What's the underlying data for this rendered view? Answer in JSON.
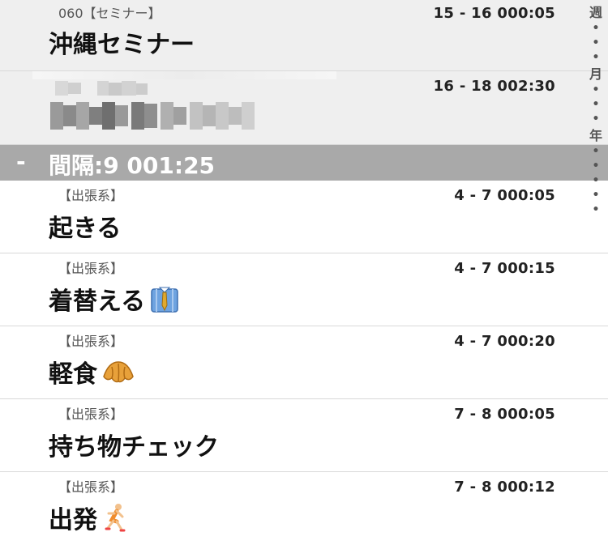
{
  "index_bar": {
    "week": "週",
    "month": "月",
    "year": "年"
  },
  "rows_top": [
    {
      "category": "060【セミナー】",
      "time": "15 - 16 000:05",
      "title": "沖縄セミナー"
    },
    {
      "category": "",
      "time": "16 - 18 002:30",
      "title": ""
    }
  ],
  "separator": {
    "dash": "-",
    "label": "間隔:9 001:25"
  },
  "rows": [
    {
      "category": "【出張系】",
      "time": "4 - 7 000:05",
      "title": "起きる",
      "emoji": ""
    },
    {
      "category": "【出張系】",
      "time": "4 - 7 000:15",
      "title": "着替える",
      "emoji": "shirt-tie-icon"
    },
    {
      "category": "【出張系】",
      "time": "4 - 7 000:20",
      "title": "軽食",
      "emoji": "croissant-icon"
    },
    {
      "category": "【出張系】",
      "time": "7 - 8 000:05",
      "title": "持ち物チェック",
      "emoji": ""
    },
    {
      "category": "【出張系】",
      "time": "7 - 8 000:12",
      "title": "出発",
      "emoji": "runner-icon"
    }
  ],
  "colors": {
    "shaded_row": "#efefef",
    "separator": "#a9a9a9",
    "divider": "#d9d9d9"
  }
}
